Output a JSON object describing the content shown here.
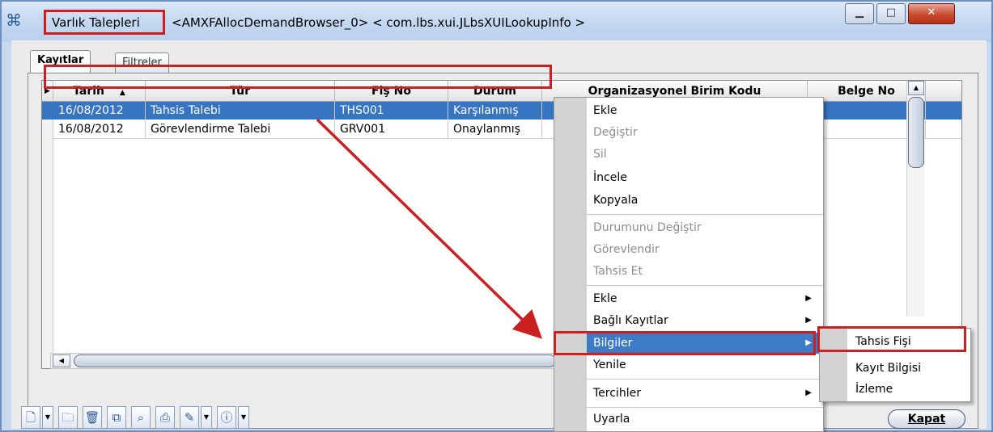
{
  "window": {
    "title_main": "Varlık Talepleri",
    "title_rest": "<AMXFAllocDemandBrowser_0> < com.lbs.xui.JLbsXUILookupInfo >",
    "minimize_icon": "minimize-icon",
    "maximize_icon": "maximize-icon",
    "close_icon": "close-icon"
  },
  "tabs": [
    {
      "label": "Kayıtlar",
      "active": true
    },
    {
      "label": "Filtreler",
      "active": false
    }
  ],
  "grid": {
    "columns": [
      "Tarih",
      "Tür",
      "Fiş No",
      "Durum",
      "Organizasyonel Birim Kodu",
      "Belge No"
    ],
    "rows": [
      [
        "16/08/2012",
        "Tahsis Talebi",
        "THS001",
        "Karşılanmış",
        "",
        ""
      ],
      [
        "16/08/2012",
        "Görevlendirme Talebi",
        "GRV001",
        "Onaylanmış",
        "",
        ""
      ]
    ]
  },
  "context_menu": {
    "items": [
      {
        "label": "Ekle",
        "enabled": true
      },
      {
        "label": "Değiştir",
        "enabled": false
      },
      {
        "label": "Sil",
        "enabled": false
      },
      {
        "label": "İncele",
        "enabled": true
      },
      {
        "label": "Kopyala",
        "enabled": true
      },
      {
        "label": "Durumunu Değiştir",
        "enabled": false
      },
      {
        "label": "Görevlendir",
        "enabled": false
      },
      {
        "label": "Tahsis Et",
        "enabled": false
      },
      {
        "label": "Ekle",
        "enabled": true,
        "submenu": true
      },
      {
        "label": "Bağlı Kayıtlar",
        "enabled": true,
        "submenu": true
      },
      {
        "label": "Bilgiler",
        "enabled": true,
        "submenu": true
      },
      {
        "label": "Yenile",
        "enabled": true
      },
      {
        "label": "Tercihler",
        "enabled": true,
        "submenu": true
      },
      {
        "label": "Uyarla",
        "enabled": true
      }
    ]
  },
  "submenu": {
    "items": [
      "Tahsis Fişi",
      "Kayıt Bilgisi",
      "İzleme"
    ]
  },
  "buttons": {
    "close": "Kapat"
  },
  "colors": {
    "highlight_red": "#cc1f1f",
    "selection_blue": "#3774c2"
  }
}
